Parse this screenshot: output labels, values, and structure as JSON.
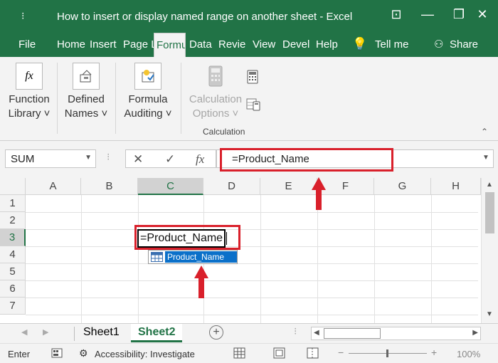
{
  "window": {
    "title": "How to insert or display named range on another sheet  -  Excel",
    "quick_access": "⁝",
    "minimize": "—",
    "restore": "❐",
    "close": "✕",
    "ribbon_display": "⊡"
  },
  "tabs": [
    "File",
    "Home",
    "Insert",
    "Page L",
    "Formu",
    "Data",
    "Revie",
    "View",
    "Devel",
    "Help"
  ],
  "tell_me": "Tell me",
  "share": "Share",
  "ribbon": {
    "function_library": [
      "Function",
      "Library ˅"
    ],
    "defined_names": [
      "Defined",
      "Names ˅"
    ],
    "formula_auditing": [
      "Formula",
      "Auditing ˅"
    ],
    "calculation_options": [
      "Calculation",
      "Options ˅"
    ],
    "group_label": "Calculation",
    "collapse": "⌃"
  },
  "formula_bar": {
    "name_box": "SUM",
    "cancel": "✕",
    "enter": "✓",
    "fx": "fx",
    "formula": "=Product_Name"
  },
  "grid": {
    "columns": [
      "A",
      "B",
      "C",
      "D",
      "E",
      "F",
      "G",
      "H"
    ],
    "rows": [
      "1",
      "2",
      "3",
      "4",
      "5",
      "6",
      "7"
    ],
    "active_column": "C",
    "active_row": "3",
    "cell_text": "=Product_Name",
    "autocomplete": "Product_Name"
  },
  "sheets": [
    "Sheet1",
    "Sheet2"
  ],
  "active_sheet": "Sheet2",
  "status": {
    "mode": "Enter",
    "accessibility": "Accessibility: Investigate",
    "zoom": "100%"
  },
  "colors": {
    "excel_green": "#217346",
    "highlight_red": "#d9202b",
    "select_blue": "#0b70c9"
  }
}
